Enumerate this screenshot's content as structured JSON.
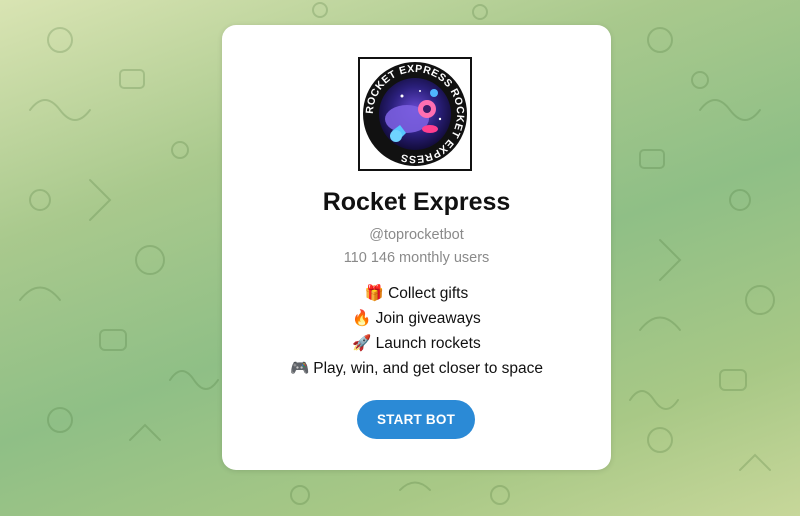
{
  "bot": {
    "name": "Rocket Express",
    "handle": "@toprocketbot",
    "monthly_users": "110 146 monthly users",
    "avatar_ring_text": "ROCKET EXPRESS ROCKET EXPRESS "
  },
  "description": [
    {
      "icon": "gift-icon",
      "glyph": "🎁",
      "text": "Collect gifts"
    },
    {
      "icon": "fire-icon",
      "glyph": "🔥",
      "text": "Join giveaways"
    },
    {
      "icon": "rocket-icon",
      "glyph": "🚀",
      "text": "Launch rockets"
    },
    {
      "icon": "gamepad-icon",
      "glyph": "🎮",
      "text": "Play, win, and get closer to space"
    }
  ],
  "start_button_label": "START BOT",
  "colors": {
    "accent": "#2b8ad6",
    "background_top": "#d9e4b3",
    "background_mid": "#8fbf86"
  }
}
